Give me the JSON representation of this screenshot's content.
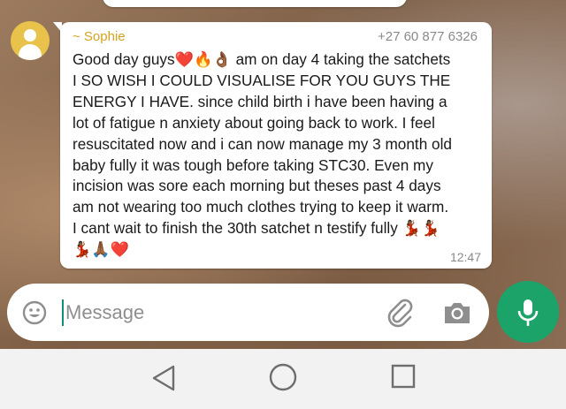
{
  "chat": {
    "message": {
      "sender": "~ Sophie",
      "phone": "+27 60 877 6326",
      "text": "Good day guys❤️🔥👌🏾  am on day 4 taking the satchets\nI SO WISH I COULD VISUALISE FOR YOU GUYS THE\nENERGY I HAVE. since child birth i have been having a\nlot of fatigue n anxiety about going back to work. I feel\nresuscitated now and i can now manage my 3 month old\nbaby fully it was tough before taking STC30. Even my\nincision was sore each morning but theses past 4 days\nam not wearing too much clothes trying to keep it warm.\nI cant wait to finish the 30th satchet n testify fully 💃🏾💃🏾\n💃🏾🙏🏾❤️",
      "time": "12:47"
    }
  },
  "composer": {
    "placeholder": "Message",
    "icons": [
      "emoji-icon",
      "attach-icon",
      "camera-icon",
      "mic-icon"
    ]
  },
  "navbar": {
    "icons": [
      "back-icon",
      "home-icon",
      "recents-icon"
    ]
  },
  "colors": {
    "sender": "#d6a321",
    "mic_button": "#1ca36a",
    "caret": "#128c7e"
  }
}
